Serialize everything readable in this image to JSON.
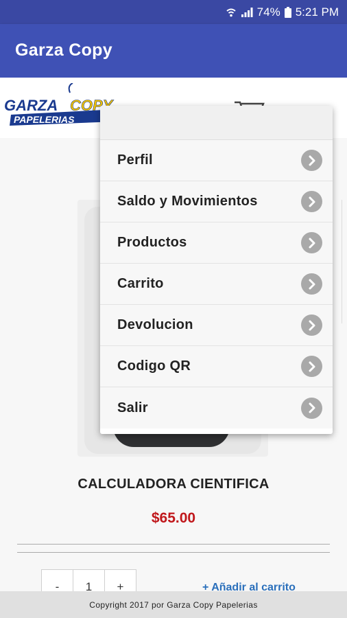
{
  "status_bar": {
    "battery": "74%",
    "time": "5:21 PM"
  },
  "app_bar": {
    "title": "Garza Copy"
  },
  "header": {
    "logo_text_top": "GARZA",
    "logo_text_copy": "COPY",
    "logo_text_bottom": "PAPELERIAS"
  },
  "menu": {
    "items": [
      {
        "label": "Perfil"
      },
      {
        "label": "Saldo y Movimientos"
      },
      {
        "label": "Productos"
      },
      {
        "label": "Carrito"
      },
      {
        "label": "Devolucion"
      },
      {
        "label": "Codigo QR"
      },
      {
        "label": "Salir"
      }
    ]
  },
  "product": {
    "name": "CALCULADORA CIENTIFICA",
    "price": "$65.00",
    "quantity": "1",
    "minus_label": "-",
    "plus_label": "+",
    "add_to_cart": "+ Añadir al carrito"
  },
  "footer": {
    "copyright": "Copyright 2017 por Garza Copy Papelerias"
  },
  "colors": {
    "app_bar": "#3f51b5",
    "status_bar": "#3a48a3",
    "price": "#c0171b",
    "link": "#2a6fbb",
    "logo_blue": "#1a3a8f",
    "logo_yellow": "#f2c300"
  }
}
